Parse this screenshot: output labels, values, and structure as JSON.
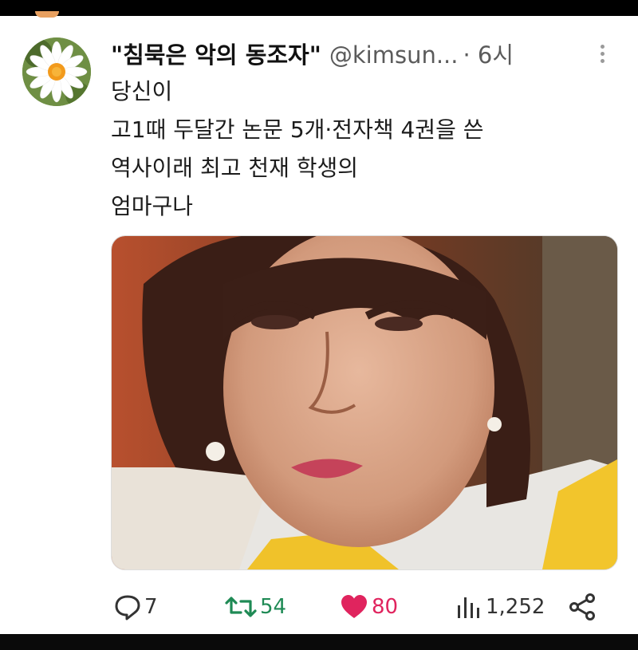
{
  "tweet": {
    "display_name": "\"침묵은 악의 동조자\"",
    "handle": "@kimsun...",
    "time": "· 6시",
    "lines": [
      "당신이",
      "고1때 두달간 논문 5개·전자책 4권을 쓴",
      "역사이래 최고 천재 학생의",
      "엄마구나"
    ]
  },
  "actions": {
    "replies": "7",
    "retweets": "54",
    "likes": "80",
    "views": "1,252"
  },
  "colors": {
    "retweet": "#1f8a55",
    "like": "#e0245e",
    "text": "#1c1c1c",
    "muted": "#5b5b5b"
  },
  "icons": [
    "more-options-icon",
    "reply-icon",
    "retweet-icon",
    "like-icon",
    "views-icon",
    "share-icon"
  ]
}
